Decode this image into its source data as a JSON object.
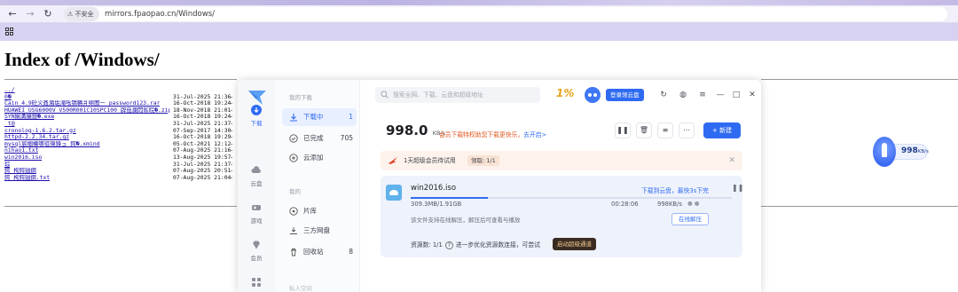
{
  "browser": {
    "security_label": "不安全",
    "url": "mirrors.fpaopao.cn/Windows/"
  },
  "page": {
    "heading": "Index of /Windows/",
    "listing": [
      {
        "name": "../",
        "date": "",
        "size": ""
      },
      {
        "name": "0�",
        "date": "31-Jul-2025 21:36",
        "size": "-"
      },
      {
        "name": "Cain_4.9砼义叒潲垢滝吆锖韀爿绵图ー password123.rar",
        "date": "16-Oct-2018 19:24",
        "size": "-"
      },
      {
        "name": "HUAWEI_USG6000V_V500R001C10SPC100_辟茄瀾悶昿晥�.zip",
        "date": "18-Nov-2018 21:01",
        "size": "-"
      },
      {
        "name": "SYN娴溝攘鋃�.exe",
        "date": "16-Oct-2018 19:24",
        "size": "-"
      },
      {
        "name": "_t@",
        "date": "31-Jul-2025 21:37",
        "size": "-"
      },
      {
        "name": "cronolog-1.6.2.tar.gz",
        "date": "07-Sep-2017 14:30",
        "size": "-"
      },
      {
        "name": "httpd-2.2.34.tar.gz",
        "date": "16-Oct-2018 19:29",
        "size": "-"
      },
      {
        "name": "mysql宸椢權哪徂璄鍏ュ 鍔�.xmind",
        "date": "05-Oct-2021 12:12",
        "size": "-"
      },
      {
        "name": "nihao1.txt",
        "date": "07-Aug-2025 21:16",
        "size": "-"
      },
      {
        "name": "win2016.iso",
        "date": "13-Aug-2025 19:57",
        "size": "-"
      },
      {
        "name": "琮",
        "date": "31-Jul-2025 21:37",
        "size": "-"
      },
      {
        "name": "鍔 枸鍔翅鋼",
        "date": "07-Aug-2025 20:51",
        "size": "-"
      },
      {
        "name": "鍔 枸鍔翅鋼.txt",
        "date": "07-Aug-2025 21:04",
        "size": "-"
      }
    ]
  },
  "floating_widget": {
    "speed": "998",
    "unit": "KB/s"
  },
  "thunder": {
    "rail": [
      {
        "label": "下载",
        "icon": "download-icon"
      },
      {
        "label": "云盘",
        "icon": "cloud-icon"
      },
      {
        "label": "游戏",
        "icon": "gamepad-icon"
      },
      {
        "label": "会员",
        "icon": "diamond-icon"
      }
    ],
    "nav": {
      "section_downloads": "我的下载",
      "items": [
        {
          "label": "下载中",
          "count": "1"
        },
        {
          "label": "已完成",
          "count": "705"
        },
        {
          "label": "云添加",
          "count": ""
        }
      ],
      "section_cloud": "我的",
      "cloud_items": [
        {
          "label": "片库",
          "count": ""
        },
        {
          "label": "三方网盘",
          "count": ""
        },
        {
          "label": "回收站",
          "count": "8"
        }
      ],
      "private_space": "私人空间"
    },
    "search_placeholder": "搜索全网、下载、云盘和超级地址",
    "login_button": "登录领云盘",
    "speed_value": "998.0",
    "speed_unit": "KB/s",
    "vip_tip_prefix": "会员下载特权助您下载更快乐，",
    "vip_tip_link": "去开启>",
    "new_button": "+ 新建",
    "trial": {
      "text": "1天超级会员待试用",
      "badge": "领取: 1/1"
    },
    "task": {
      "filename": "win2016.iso",
      "cloud_link": "下载到云盘，最快3s下完",
      "progress": 0.24,
      "size": "309.3MB/1.91GB",
      "remaining": "00:28:06",
      "speed": "998KB/s",
      "hint": "该文件支持在线解压，解压后可查看与播放",
      "unzip_button": "在线解压",
      "resources": "资源数: 1/1",
      "resources_tip": "进一步优化资源数连接，可尝试",
      "accel_button": "启动超级通道"
    }
  }
}
